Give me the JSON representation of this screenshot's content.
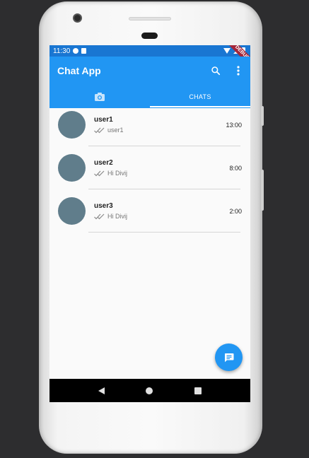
{
  "status_bar": {
    "time": "11:30"
  },
  "debug_banner": "DEBUG",
  "app_bar": {
    "title": "Chat App"
  },
  "tabs": [
    {
      "icon": "camera-icon",
      "label": ""
    },
    {
      "label": "CHATS"
    }
  ],
  "chats": [
    {
      "name": "user1",
      "message": "user1",
      "time": "13:00"
    },
    {
      "name": "user2",
      "message": "Hi Divij",
      "time": "8:00"
    },
    {
      "name": "user3",
      "message": "Hi Divij",
      "time": "2:00"
    }
  ],
  "colors": {
    "primary": "#2196f3",
    "status_bar": "#1976d2",
    "avatar": "#607d8b",
    "debug_ribbon": "#a3263a"
  }
}
